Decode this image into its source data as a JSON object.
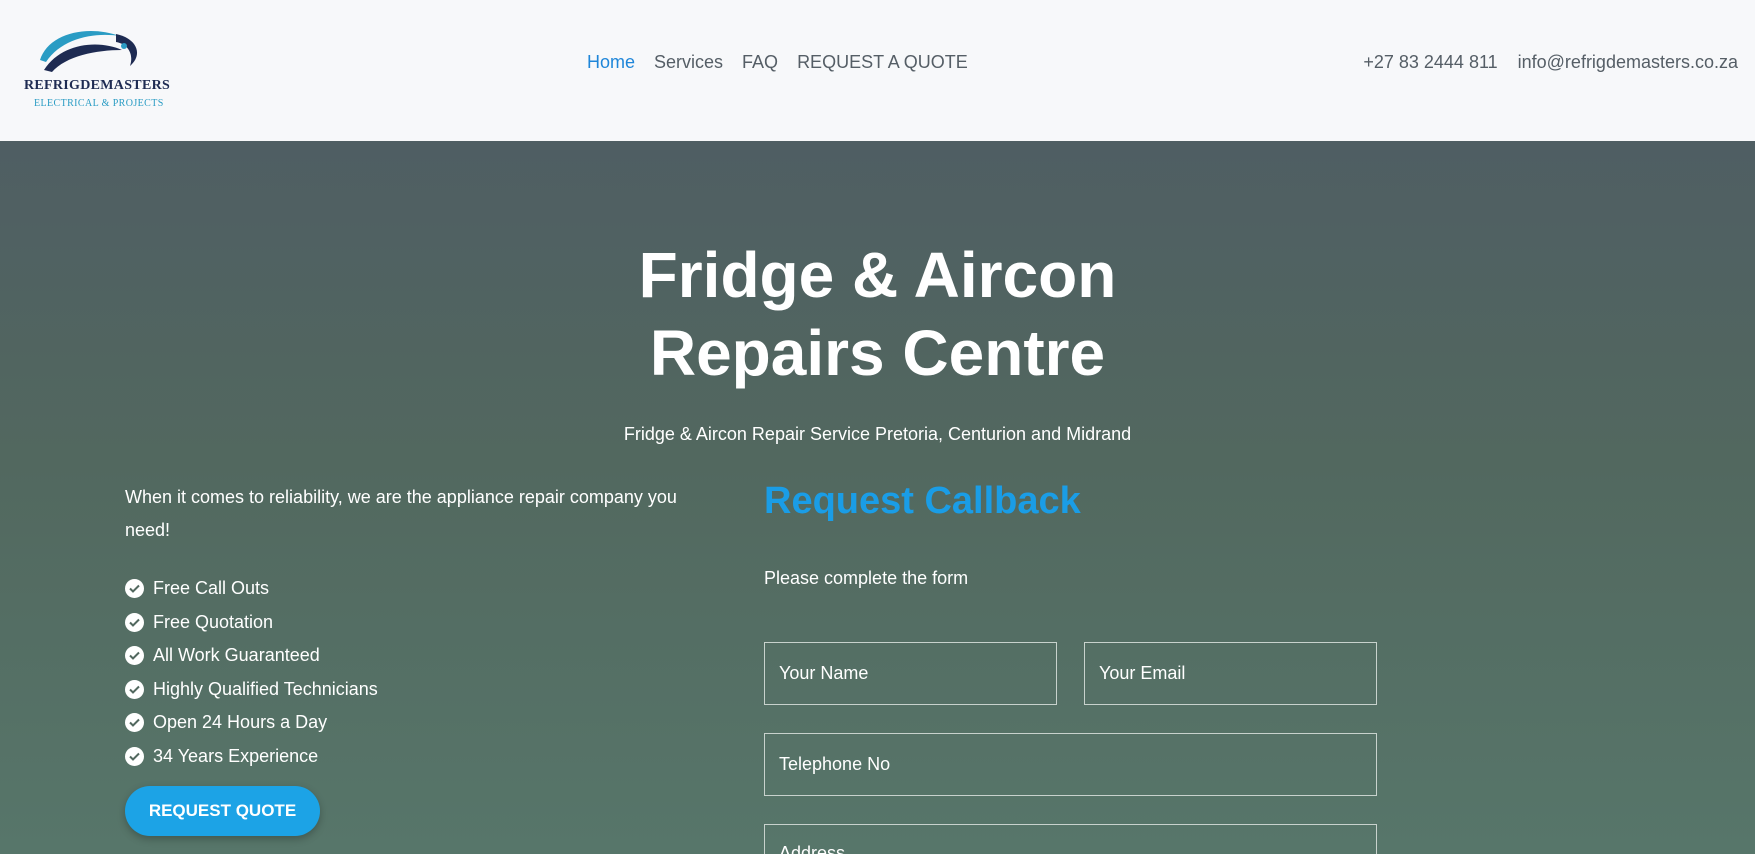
{
  "brand": {
    "name": "REFRIGDEMASTERS",
    "tagline": "ELECTRICAL & PROJECTS"
  },
  "nav": [
    {
      "label": "Home",
      "active": true
    },
    {
      "label": "Services",
      "active": false
    },
    {
      "label": "FAQ",
      "active": false
    },
    {
      "label": "REQUEST A QUOTE",
      "active": false
    }
  ],
  "contact": {
    "phone": "+27 83 2444 811",
    "email": "info@refrigdemasters.co.za"
  },
  "hero": {
    "title_line1": "Fridge & Aircon",
    "title_line2": "Repairs Centre",
    "subtitle": "Fridge & Aircon Repair Service Pretoria, Centurion and Midrand",
    "intro": "When it comes to reliability, we are the appliance repair company you need!",
    "features": [
      "Free Call Outs",
      "Free Quotation",
      "All Work Guaranteed",
      "Highly Qualified Technicians",
      "Open 24 Hours a Day",
      "34 Years Experience"
    ],
    "cta_label": "REQUEST QUOTE"
  },
  "callback": {
    "title": "Request Callback",
    "subtitle": "Please complete the form",
    "fields": {
      "name_placeholder": "Your Name",
      "email_placeholder": "Your Email",
      "phone_placeholder": "Telephone No",
      "address_placeholder": "Address"
    }
  },
  "colors": {
    "accent": "#1f86d9",
    "button": "#1ca3e6",
    "callback_title": "#1a9de6",
    "header_bg": "#f7f8fa",
    "hero_bg": "#52685f"
  }
}
